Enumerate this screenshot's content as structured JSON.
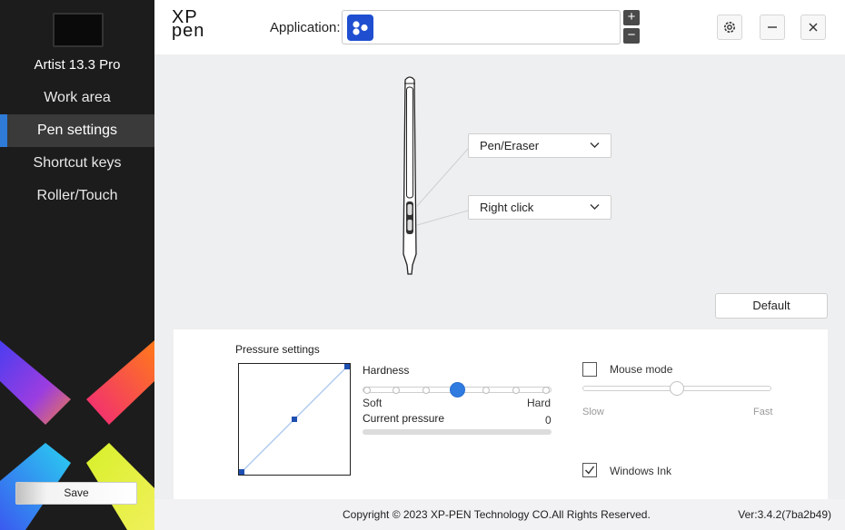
{
  "sidebar": {
    "device_name": "Artist 13.3 Pro",
    "items": [
      {
        "label": "Work area",
        "active": false
      },
      {
        "label": "Pen settings",
        "active": true
      },
      {
        "label": "Shortcut keys",
        "active": false
      },
      {
        "label": "Roller/Touch",
        "active": false
      }
    ],
    "save_label": "Save"
  },
  "header": {
    "logo_top": "XP",
    "logo_bottom": "pen",
    "application_label": "Application:",
    "add_label": "+",
    "remove_label": "−",
    "icons": [
      "gear-icon",
      "minimize-icon",
      "close-icon"
    ]
  },
  "pen": {
    "upper_button": "Pen/Eraser",
    "lower_button": "Right click",
    "default_label": "Default"
  },
  "pressure": {
    "title": "Pressure settings",
    "hardness_label": "Hardness",
    "hardness_level": 0.5,
    "soft_label": "Soft",
    "hard_label": "Hard",
    "current_pressure_label": "Current pressure",
    "current_pressure_value": "0",
    "current_pressure_fraction": 0
  },
  "mouse_mode": {
    "label": "Mouse mode",
    "checked": false,
    "slow_label": "Slow",
    "fast_label": "Fast",
    "speed_level": 0.5
  },
  "windows_ink": {
    "label": "Windows Ink",
    "checked": true
  },
  "footer": {
    "copyright": "Copyright © 2023  XP-PEN Technology CO.All Rights Reserved.",
    "version": "Ver:3.4.2(7ba2b49)"
  },
  "colors": {
    "accent": "#2f7be0",
    "sidebar_bg": "#1c1c1c",
    "main_bg": "#eeeff1"
  }
}
